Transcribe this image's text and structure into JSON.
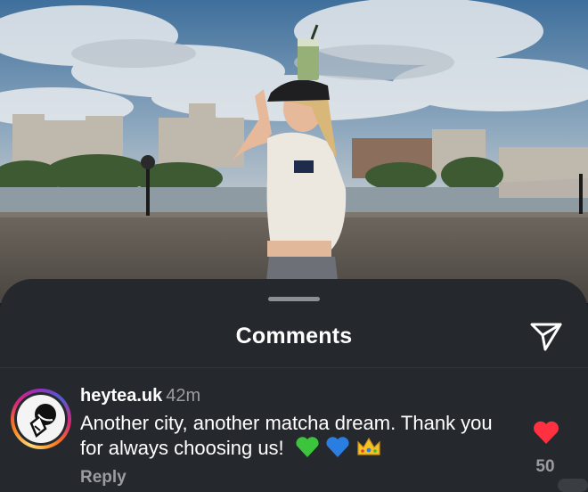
{
  "sheet": {
    "title": "Comments",
    "share_icon": "paper-plane-icon"
  },
  "comment": {
    "avatar_icon": "heytea-logo-avatar",
    "username": "heytea.uk",
    "time": "42m",
    "text": "Another city, another matcha dream. Thank you for always choosing us!",
    "emojis": [
      "green-heart-emoji",
      "blue-heart-emoji",
      "crown-emoji"
    ],
    "reply_label": "Reply",
    "like_icon": "heart-icon",
    "like_count": "50"
  },
  "colors": {
    "sheet_bg": "#25292e",
    "like_red": "#ff3040",
    "muted_text": "#9a9ca1"
  }
}
